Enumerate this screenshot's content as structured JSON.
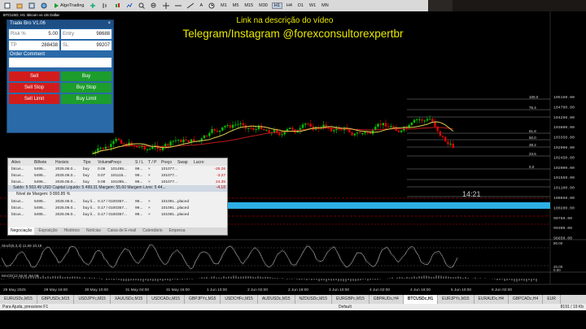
{
  "toolbar": {
    "items": [
      "AlgoTrading"
    ],
    "timeframes": [
      "M1",
      "M5",
      "M15",
      "M30",
      "H1",
      "H4",
      "D1",
      "W1",
      "MN"
    ],
    "active_timeframe": "H1"
  },
  "overlay": {
    "line1": "Link na descrição do vídeo",
    "line2": "Telegram/Instagram @forexconsultorexpertbr"
  },
  "chart": {
    "symbol_header": "BTCUSD, H1: Bitcoin vs US Dollar",
    "time_label": "14:21",
    "price_labels": [
      "105150.00",
      "104700.00",
      "104250.00",
      "103800.00",
      "103350.00",
      "102900.00",
      "102450.00",
      "102000.00",
      "101550.00",
      "101100.00",
      "100650.00",
      "100200.00",
      "99750.00",
      "99300.00",
      "98850.00"
    ],
    "fib_labels": [
      "100.0",
      "76.4",
      "61.8",
      "50.0",
      "38.2",
      "23.6",
      "0.0"
    ],
    "x_labels": [
      "29 May 2025",
      "29 May 16:00",
      "30 May 10:00",
      "31 May 04:00",
      "31 May 16:00",
      "1 Jun 10:00",
      "2 Jun 02:00",
      "2 Jun 18:00",
      "3 Jun 10:00",
      "4 Jun 02:00",
      "4 Jun 18:00",
      "5 Jun 10:00",
      "6 Jun 02:00"
    ],
    "stoch_label": "Stoch(5,3,3) 11.69 10.18",
    "stoch_levels": [
      "80.00",
      "20.00",
      "0.00"
    ],
    "macd_label": "MACD(12,26,9) -94.08",
    "colors": {
      "bull": "#00c000",
      "bear": "#e00000",
      "ma_red": "#c01818",
      "ma_yellow": "#e0d050",
      "highlight": "#2fb8f0"
    }
  },
  "trade_panel": {
    "title": "Trade Bro V1.06",
    "risk_label": "Risk %",
    "risk_value": "5.00",
    "entry_label": "Entry",
    "entry_value": "98688",
    "tp_label": "TP",
    "tp_value": "288438",
    "sl_label": "SL",
    "sl_value": "99207",
    "order_comment_label": "Order Comment",
    "buttons": [
      "Sell",
      "Buy",
      "Sell Stop",
      "Buy Stop",
      "Sell Limit",
      "Buy Limit"
    ]
  },
  "orders": {
    "headers": [
      "Ativo",
      "Bilhete",
      "Horário",
      "Tipo",
      "Volume",
      "Preço",
      "S / L",
      "T / P",
      "Preço",
      "Swap",
      "Lucro"
    ],
    "rows": [
      [
        "btcus...",
        "5495...",
        "2025.06.0...",
        "buy",
        "0.06",
        "101495...",
        "99...",
        "×",
        "101077...",
        "",
        "-25.26"
      ],
      [
        "btcus...",
        "5495...",
        "2025.06.0...",
        "buy",
        "0.07",
        "101115...",
        "99...",
        "×",
        "101077...",
        "",
        "-3.27"
      ],
      [
        "btcus...",
        "5495...",
        "2025.06.0...",
        "buy",
        "0.08",
        "101095...",
        "99...",
        "×",
        "101077...",
        "",
        "24.35"
      ]
    ],
    "balance_line": "Saldo: 5 503.49 USD  Capital Líquido: 5 499.31  Margem: 55.60  Margem Livre: 5 44...",
    "balance_pl": "-4.18",
    "margin_line": "Nível de Margem: 9 890.85 %",
    "pending_rows": [
      [
        "btcus...",
        "5495...",
        "2025.06.0...",
        "buy li...",
        "0.17 / 0",
        "100357...",
        "99...",
        "×",
        "101091...",
        "placed"
      ],
      [
        "btcus...",
        "5495...",
        "2025.06.0...",
        "buy li...",
        "0.17 / 0",
        "100357...",
        "99...",
        "×",
        "101091...",
        "placed"
      ],
      [
        "btcus...",
        "5495...",
        "2025.06.0...",
        "buy li...",
        "0.17 / 0",
        "100357...",
        "99...",
        "×",
        "101091...",
        "placed"
      ]
    ],
    "tabs": [
      "Negociação",
      "Exposição",
      "Histórico",
      "Notícias",
      "Caixa de E-mail",
      "Calendário",
      "Empresa"
    ],
    "active_tab": "Negociação"
  },
  "symbol_tabs": {
    "items": [
      "EURUSDc,M15",
      "GBPUSDc,M15",
      "USDJPYc,M15",
      "XAUUSDc,M15",
      "USDCADc,M15",
      "GBPJPYc,M15",
      "USDCHFc,M15",
      "AUDUSDc,M15",
      "NZDUSDc,M15",
      "EURGBPc,M15",
      "GBPAUDc,H4",
      "BTCUSDc,H1",
      "EURJPYc,M15",
      "EURAUDc,H4",
      "GBPCADc,H4",
      "EUR"
    ],
    "active": "BTCUSDc,H1"
  },
  "status": {
    "left": "Para Ajuda, pressione F1",
    "mid": "Default",
    "right": "8191 / 19 Kb"
  }
}
